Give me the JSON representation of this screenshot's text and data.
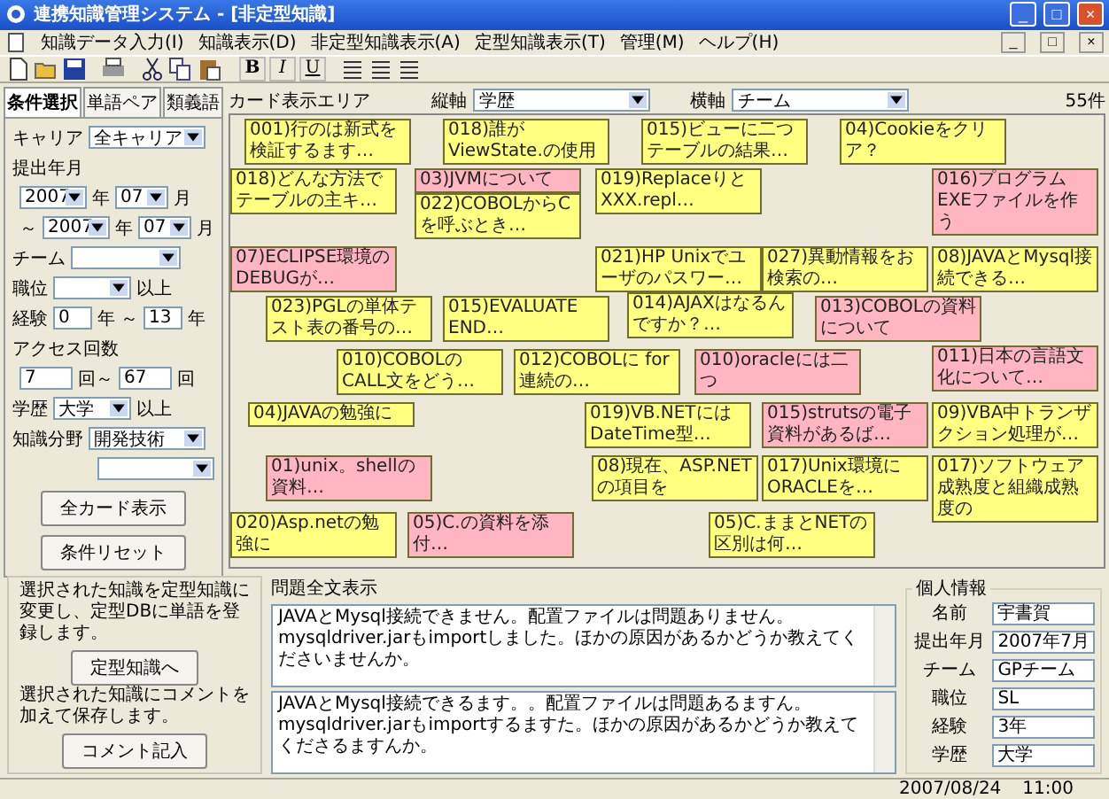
{
  "window": {
    "title": "連携知識管理システム - [非定型知識]",
    "controls": [
      "_",
      "□",
      "×"
    ]
  },
  "menu": {
    "items": [
      "知識データ入力(I)",
      "知識表示(D)",
      "非定型知識表示(A)",
      "定型知識表示(T)",
      "管理(M)",
      "ヘルプ(H)"
    ],
    "mdi_controls": [
      "_",
      "□",
      "×"
    ]
  },
  "toolbar": {
    "format_buttons": [
      "B",
      "I",
      "U"
    ]
  },
  "tabs": [
    {
      "label": "条件選択",
      "selected": true
    },
    {
      "label": "単語ペア",
      "selected": false
    },
    {
      "label": "類義語",
      "selected": false
    }
  ],
  "conditions": {
    "career": {
      "label": "キャリア",
      "value": "全キャリア"
    },
    "period": {
      "label": "提出年月",
      "tilde": "～",
      "from": {
        "year": "2007",
        "year_unit": "年",
        "month": "07",
        "month_unit": "月"
      },
      "to": {
        "year": "2007",
        "year_unit": "年",
        "month": "07",
        "month_unit": "月"
      }
    },
    "team": {
      "label": "チーム"
    },
    "position": {
      "label": "職位",
      "suffix": "以上"
    },
    "experience": {
      "label": "経験",
      "from": "0",
      "from_unit": "年",
      "to": "13",
      "to_unit": "年",
      "tilde": "～"
    },
    "access": {
      "label": "アクセス回数",
      "from": "7",
      "to": "67",
      "unit": "回",
      "tilde": "回～"
    },
    "education": {
      "label": "学歴",
      "value": "大学",
      "suffix": "以上"
    },
    "field": {
      "label": "知識分野",
      "value": "開発技術"
    },
    "buttons": [
      "全カード表示",
      "条件リセット"
    ]
  },
  "card_area": {
    "title": "カード表示エリア",
    "y_axis": {
      "label": "縦軸",
      "value": "学歴"
    },
    "x_axis": {
      "label": "横軸",
      "value": "チーム"
    },
    "count": "55件",
    "cards": [
      {
        "text": "001)行のは新式を検証するます…",
        "color": "#ffff80"
      },
      {
        "text": "018)誰が ViewState.の使用",
        "color": "#ffff80"
      },
      {
        "text": "015)ビューに二つテーブルの結果…",
        "color": "#ffff80"
      },
      {
        "text": "04)Cookieをクリア？",
        "color": "#ffff80"
      },
      {
        "text": "018)どんな方法でテーブルの主キ…",
        "color": "#ffff80"
      },
      {
        "text": "03)JVMについて",
        "color": "#ffb6c1"
      },
      {
        "text": "022)COBOLからCを呼ぶとき…",
        "color": "#ffff80"
      },
      {
        "text": "019)Replaceりと XXX.repl…",
        "color": "#ffff80"
      },
      {
        "text": "016)プログラム EXEファイルを作う",
        "color": "#ffb6c1"
      },
      {
        "text": "07)ECLIPSE環境のDEBUGが…",
        "color": "#ffb6c1"
      },
      {
        "text": "021)HP Unixでユーザのパスワー…",
        "color": "#ffff80"
      },
      {
        "text": "027)異動情報をお検索の…",
        "color": "#ffff80"
      },
      {
        "text": "08)JAVAとMysql接続できる…",
        "color": "#ffff80"
      },
      {
        "text": "023)PGLの単体テスト表の番号の…",
        "color": "#ffff80"
      },
      {
        "text": "015)EVALUATE END…",
        "color": "#ffff80"
      },
      {
        "text": "014)AJAXはなるんですか？…",
        "color": "#ffff80"
      },
      {
        "text": "013)COBOLの資料について",
        "color": "#ffb6c1"
      },
      {
        "text": "010)COBOLのCALL文をどう…",
        "color": "#ffff80"
      },
      {
        "text": "012)COBOLに for 連続の…",
        "color": "#ffff80"
      },
      {
        "text": "010)oracleには二つ",
        "color": "#ffb6c1"
      },
      {
        "text": "011)日本の言語文化について…",
        "color": "#ffb6c1"
      },
      {
        "text": "04)JAVAの勉強に",
        "color": "#ffff80"
      },
      {
        "text": "019)VB.NETには DateTime型…",
        "color": "#ffff80"
      },
      {
        "text": "015)strutsの電子資料があるば…",
        "color": "#ffb6c1"
      },
      {
        "text": "09)VBA中トランザクション処理が…",
        "color": "#ffff80"
      },
      {
        "text": "01)unix。shellの資料…",
        "color": "#ffb6c1"
      },
      {
        "text": "08)現在、ASP.NETの項目を",
        "color": "#ffff80"
      },
      {
        "text": "017)Unix環境に ORACLEを…",
        "color": "#ffff80"
      },
      {
        "text": "017)ソフトウェア成熟度と組織成熟度の",
        "color": "#ffff80"
      },
      {
        "text": "020)Asp.netの勉強に",
        "color": "#ffff80"
      },
      {
        "text": "05)C.の資料を添付…",
        "color": "#ffb6c1"
      },
      {
        "text": "05)C.ままとNETの区別は何…",
        "color": "#ffff80"
      }
    ]
  },
  "actions": [
    {
      "description": "選択された知識を定型知識に変更し、定型DBに単語を登録します。",
      "button": "定型知識へ"
    },
    {
      "description": "選択された知識にコメントを加えて保存します。",
      "button": "コメント記入"
    }
  ],
  "question": {
    "title": "問題全文表示",
    "texts": [
      "JAVAとMysql接続できません。配置ファイルは問題ありません。mysqldriver.jarもimportしました。ほかの原因があるかどうか教えてくださいませんか。",
      "JAVAとMysql接続できるます。。配置ファイルは問題あるますん。mysqldriver.jarもimportするますた。ほかの原因があるかどうか教えてくださるますんか。"
    ]
  },
  "personal": {
    "title": "個人情報",
    "fields": [
      {
        "label": "名前",
        "value": "宇書賀"
      },
      {
        "label": "提出年月",
        "value": "2007年7月"
      },
      {
        "label": "チーム",
        "value": "GPチーム"
      },
      {
        "label": "職位",
        "value": "SL"
      },
      {
        "label": "経験",
        "value": "3年"
      },
      {
        "label": "学歴",
        "value": "大学"
      }
    ]
  },
  "status_bar": [
    "2007/08/24",
    "11:00"
  ]
}
